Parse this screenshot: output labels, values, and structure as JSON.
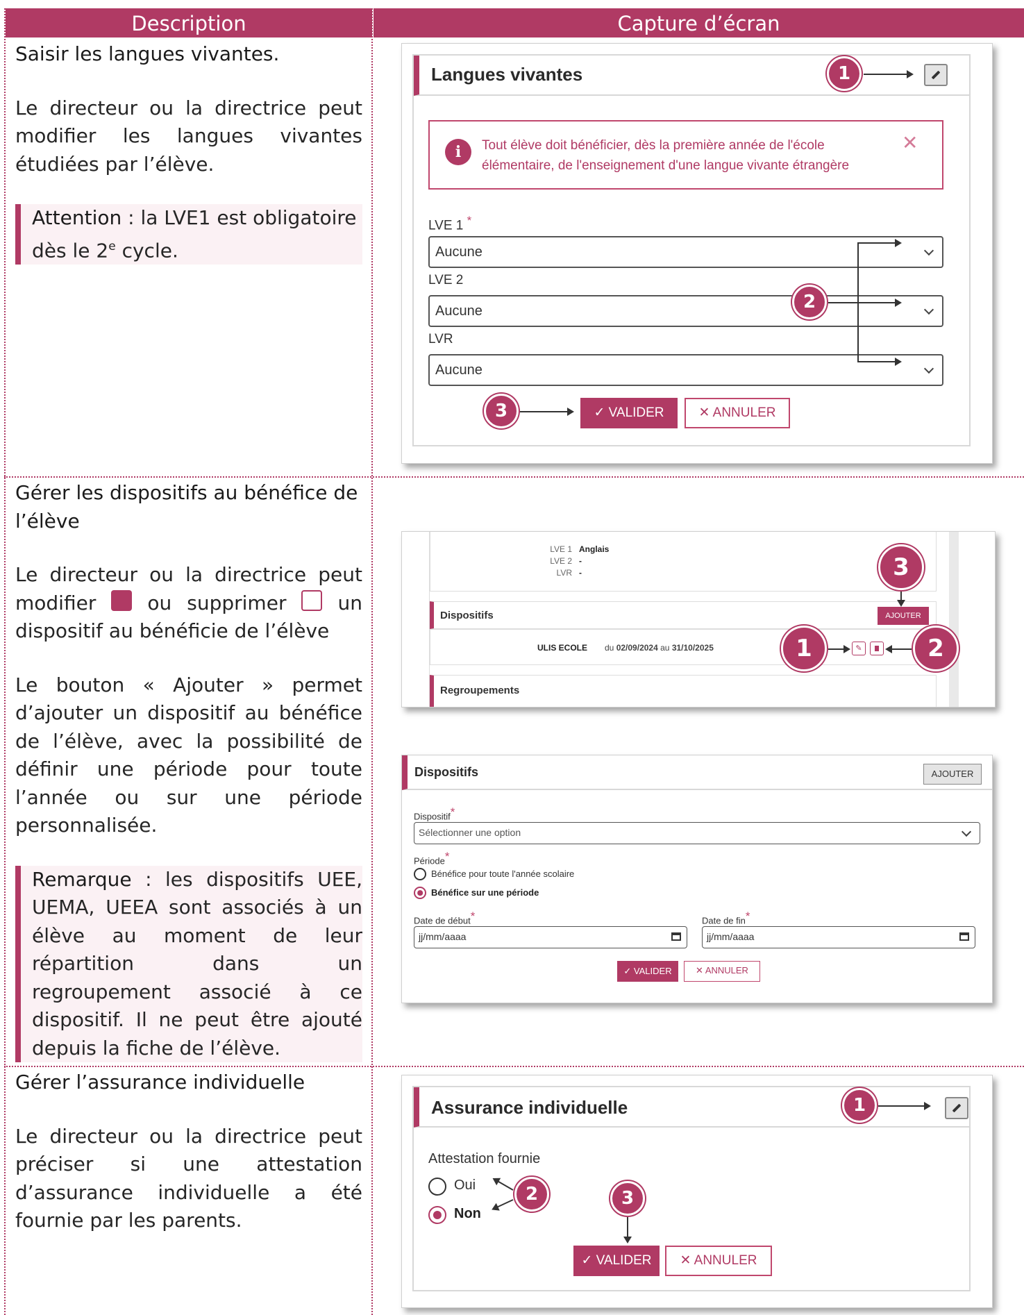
{
  "table": {
    "col_description": "Description",
    "col_capture": "Capture d’écran"
  },
  "row1": {
    "title": "Saisir les langues vivantes.",
    "text": "Le directeur ou la directrice peut modifier les langues vivantes étudiées par l’élève.",
    "note_keyword": "Attention",
    "note_text_a": " : la LVE1 est obligatoire dès le 2",
    "note_sup": "e",
    "note_text_b": " cycle.",
    "shot": {
      "card_title": "Langues vivantes",
      "alert_icon": "i",
      "alert_text": "Tout élève doit bénéficier, dès la première année de l'école élémentaire, de l'enseignement d'une langue vivante étrangère",
      "alert_close": "✕",
      "fields": [
        {
          "label": "LVE 1",
          "required": "*",
          "value": "Aucune"
        },
        {
          "label": "LVE 2",
          "required": "",
          "value": "Aucune"
        },
        {
          "label": "LVR",
          "required": "",
          "value": "Aucune"
        }
      ],
      "validate": "✓ VALIDER",
      "cancel": "✕ ANNULER",
      "badges": [
        "1",
        "2",
        "3"
      ]
    }
  },
  "row2": {
    "title": "Gérer les dispositifs au bénéfice de l’élève",
    "text_a": "Le directeur ou la directrice peut modifier",
    "text_b": "ou supprimer",
    "text_c": "un dispositif au bénéficie de l’élève",
    "text2": "Le bouton « Ajouter » permet d’ajouter un dispositif au bénéfice de l’élève, avec la possibilité de définir une période pour toute l’année ou sur une période personnalisée.",
    "note_keyword": "Remarque",
    "note_text": " : les dispositifs UEE, UEMA, UEEA sont associés à un élève au moment de leur répartition dans un regroupement associé à ce dispositif. Il ne peut être ajouté depuis la fiche de l’élève.",
    "shot1": {
      "lv_labels": [
        "LVE 1",
        "LVE 2",
        "LVR"
      ],
      "lv_values": [
        "Anglais",
        "-",
        "-"
      ],
      "section_title": "Dispositifs",
      "add_button": "AJOUTER",
      "dispositif_name": "ULIS ECOLE",
      "period_from": "du",
      "period_start": "02/09/2024",
      "period_to": "au",
      "period_end": "31/10/2025",
      "next_section": "Regroupements",
      "badges": [
        "3",
        "1",
        "2"
      ]
    },
    "shot2": {
      "card_title": "Dispositifs",
      "add_button": "AJOUTER",
      "dispositif_label": "Dispositif",
      "dispositif_placeholder": "Sélectionner une option",
      "periode_label": "Période",
      "option_year": "Bénéfice pour toute l'année scolaire",
      "option_period": "Bénéfice sur une période",
      "date_start_label": "Date de début",
      "date_end_label": "Date de fin",
      "date_placeholder": "jj/mm/aaaa",
      "required": "*",
      "validate": "✓ VALIDER",
      "cancel": "✕ ANNULER"
    }
  },
  "row3": {
    "title": "Gérer l’assurance individuelle",
    "text": "Le directeur ou la directrice peut préciser si une attestation d’assurance individuelle a été fournie par les parents.",
    "shot": {
      "card_title": "Assurance individuelle",
      "field_label": "Attestation fournie",
      "option_yes": "Oui",
      "option_no": "Non",
      "validate": "✓ VALIDER",
      "cancel": "✕ ANNULER",
      "badges": [
        "1",
        "2",
        "3"
      ]
    }
  }
}
